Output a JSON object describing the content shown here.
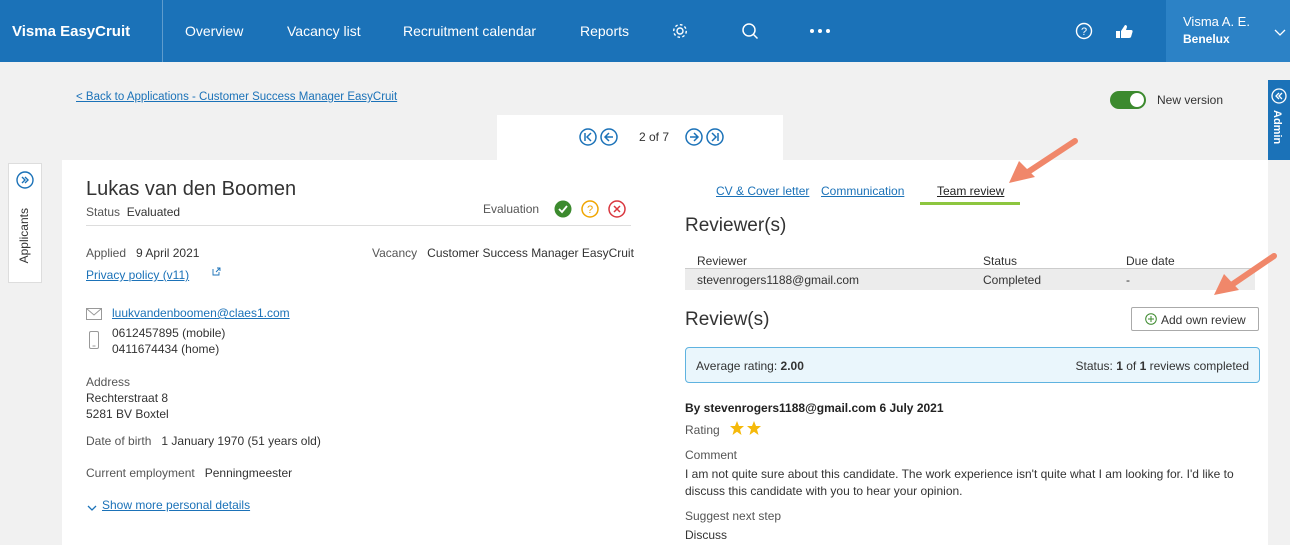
{
  "nav": {
    "brand": "Visma EasyCruit",
    "items": [
      "Overview",
      "Vacancy list",
      "Recruitment calendar",
      "Reports"
    ],
    "user_name": "Visma A. E.",
    "user_org": "Benelux"
  },
  "header": {
    "back_link": "< Back to Applications - Customer Success Manager EasyCruit",
    "new_version_label": "New version",
    "admin_label": "Admin",
    "pager_text": "2 of 7"
  },
  "sidebar": {
    "applicants_label": "Applicants"
  },
  "candidate": {
    "name": "Lukas van den Boomen",
    "status_label": "Status",
    "status_value": "Evaluated",
    "evaluation_label": "Evaluation",
    "applied_label": "Applied",
    "applied_value": "9 April 2021",
    "vacancy_label": "Vacancy",
    "vacancy_value": "Customer Success Manager EasyCruit",
    "privacy_link": "Privacy policy (v11)",
    "email": "luukvandenboomen@claes1.com",
    "phone_mobile": "0612457895 (mobile)",
    "phone_home": "0411674434 (home)",
    "address_label": "Address",
    "address_line1": "Rechterstraat 8",
    "address_line2": "5281 BV Boxtel",
    "dob_label": "Date of birth",
    "dob_value": "1 January 1970 (51 years old)",
    "employment_label": "Current employment",
    "employment_value": "Penningmeester",
    "show_more": "Show more personal details"
  },
  "tabs": [
    "CV & Cover letter",
    "Communication",
    "Team review"
  ],
  "reviewers": {
    "heading": "Reviewer(s)",
    "columns": [
      "Reviewer",
      "Status",
      "Due date"
    ],
    "rows": [
      [
        "stevenrogers1188@gmail.com",
        "Completed",
        "-"
      ]
    ]
  },
  "reviews": {
    "heading": "Review(s)",
    "add_button": "Add own review",
    "avg_label": "Average rating:",
    "avg_value": "2.00",
    "status_label": "Status:",
    "status_done": "1",
    "status_of": "of",
    "status_total": "1",
    "status_suffix": "reviews completed",
    "review_by": "By stevenrogers1188@gmail.com 6 July 2021",
    "rating_label": "Rating",
    "rating_stars": 2,
    "comment_label": "Comment",
    "comment": "I am not quite sure about this candidate. The work experience isn't quite what I am looking for. I'd like to discuss this candidate with you to hear your opinion.",
    "suggest_label": "Suggest next step",
    "suggest_value": "Discuss"
  },
  "colors": {
    "brand_blue": "#1b72b8",
    "accent_green": "#8dc63f",
    "annotation_orange": "#f0876a"
  }
}
